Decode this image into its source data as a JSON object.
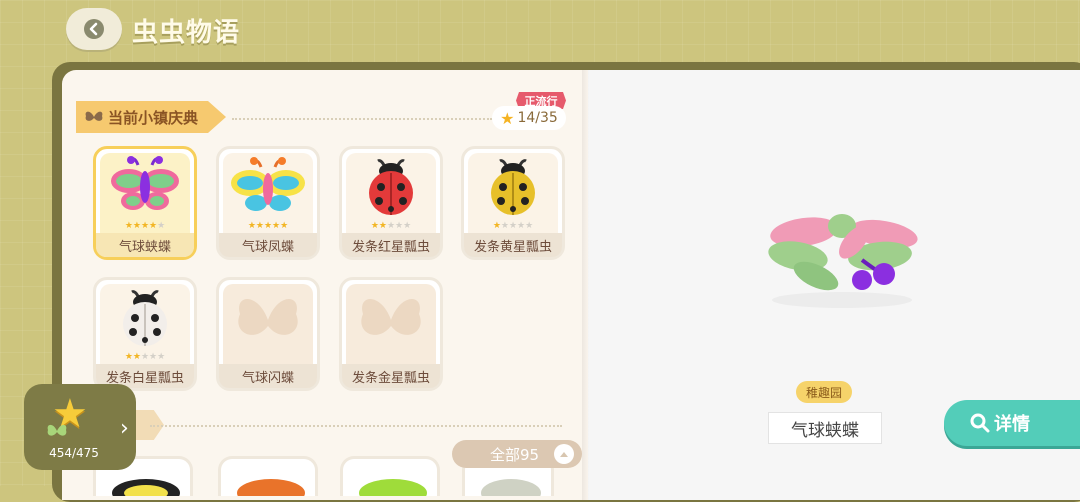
{
  "header": {
    "title": "虫虫物语"
  },
  "section": {
    "title": "当前小镇庆典",
    "tag": "正流行",
    "progress": "14/35"
  },
  "cards": [
    {
      "name": "气球蛱蝶",
      "stars": 5,
      "rarity_on": 5,
      "selected": true,
      "locked": false,
      "art": "balloon-butterfly-pink"
    },
    {
      "name": "气球凤蝶",
      "stars": 5,
      "rarity_on": 5,
      "selected": false,
      "locked": false,
      "art": "balloon-butterfly-yellow"
    },
    {
      "name": "发条红星瓢虫",
      "stars": 5,
      "rarity_on": 2,
      "selected": false,
      "locked": false,
      "art": "wind-up-ladybug-red"
    },
    {
      "name": "发条黄星瓢虫",
      "stars": 5,
      "rarity_on": 1,
      "selected": false,
      "locked": false,
      "art": "wind-up-ladybug-yellow"
    },
    {
      "name": "发条白星瓢虫",
      "stars": 5,
      "rarity_on": 2,
      "selected": false,
      "locked": false,
      "art": "wind-up-ladybug-white"
    },
    {
      "name": "气球闪蝶",
      "stars": 0,
      "rarity_on": 0,
      "selected": false,
      "locked": true,
      "art": "butterfly-silhouette"
    },
    {
      "name": "发条金星瓢虫",
      "stars": 0,
      "rarity_on": 0,
      "selected": false,
      "locked": true,
      "art": "butterfly-silhouette"
    }
  ],
  "detail": {
    "badge": "稚趣园",
    "name": "气球蛱蝶",
    "detail_button": "详情"
  },
  "collection": {
    "count": "454/475"
  },
  "filter": {
    "label": "全部95"
  },
  "colors": {
    "accent": "#53cdb9",
    "banner": "#f6c96f",
    "background": "#cdc57e"
  }
}
